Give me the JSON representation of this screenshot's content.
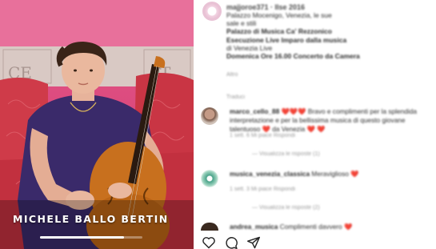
{
  "media": {
    "caption": "MICHELE BALLO BERTIN",
    "progress_fraction": 0.82
  },
  "post": {
    "username": "majjoroe371 · Ilse 2016",
    "description_lines": [
      "Palazzo Mocenigo, Venezia, le sue",
      "sale e stili",
      "Palazzo di Musica Ca' Rezzonico",
      "Esecuzione Live Imparo dalla musica",
      "di Venezia Live",
      "Domenica Ore 16.00 Concerto da Camera"
    ],
    "more_label": "Altro",
    "translate_label": "Traduci"
  },
  "comments": [
    {
      "username": "marco_cello_88",
      "hearts": "❤️❤️❤️",
      "text": "Bravo e complimenti per la splendida interpretazione",
      "text2": "e per la bellissima musica di questo giovane talentuoso ❤️ da Venezia ❤️ ❤️",
      "meta": "1 sett.   6 Mi piace   Rispondi",
      "replies": "—  Visualizza le risposte (1)"
    },
    {
      "username": "musica_venezia_classica",
      "hearts": "❤️",
      "text": "Meraviglioso ❤️",
      "text2": "",
      "meta": "1 sett.   3 Mi piace   Rispondi",
      "replies": "—  Visualizza le risposte (2)"
    },
    {
      "username": "andrea_musica",
      "hearts": "❤️❤️",
      "text": "Complimenti davvero ❤️",
      "text2": "",
      "meta": "",
      "replies": ""
    }
  ],
  "colors": {
    "accent": "#e0245e",
    "background": "#ffffff"
  },
  "icons": [
    "heart-icon",
    "comment-icon",
    "share-icon"
  ]
}
